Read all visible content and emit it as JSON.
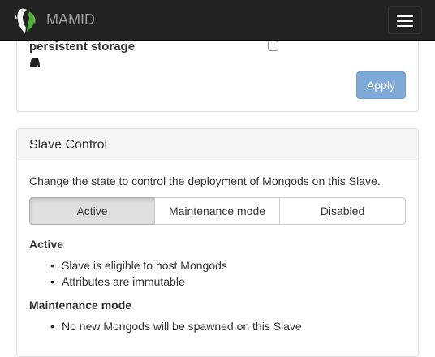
{
  "navbar": {
    "brand": "MAMID",
    "logo_icon": "mamid-logo-icon",
    "menu_icon": "hamburger-menu-icon"
  },
  "storage": {
    "label": "persistent storage",
    "icon": "hard-drive-icon",
    "checked": false,
    "apply_label": "Apply"
  },
  "slave_control": {
    "title": "Slave Control",
    "intro": "Change the state to control the deployment of Mongods on this Slave.",
    "states": [
      "Active",
      "Maintenance mode",
      "Disabled"
    ],
    "selected_state": "Active",
    "sections": [
      {
        "heading": "Active",
        "items": [
          "Slave is eligible to host Mongods",
          "Attributes are immutable"
        ]
      },
      {
        "heading": "Maintenance mode",
        "items": [
          "No new Mongods will be spawned on this Slave"
        ]
      }
    ]
  }
}
